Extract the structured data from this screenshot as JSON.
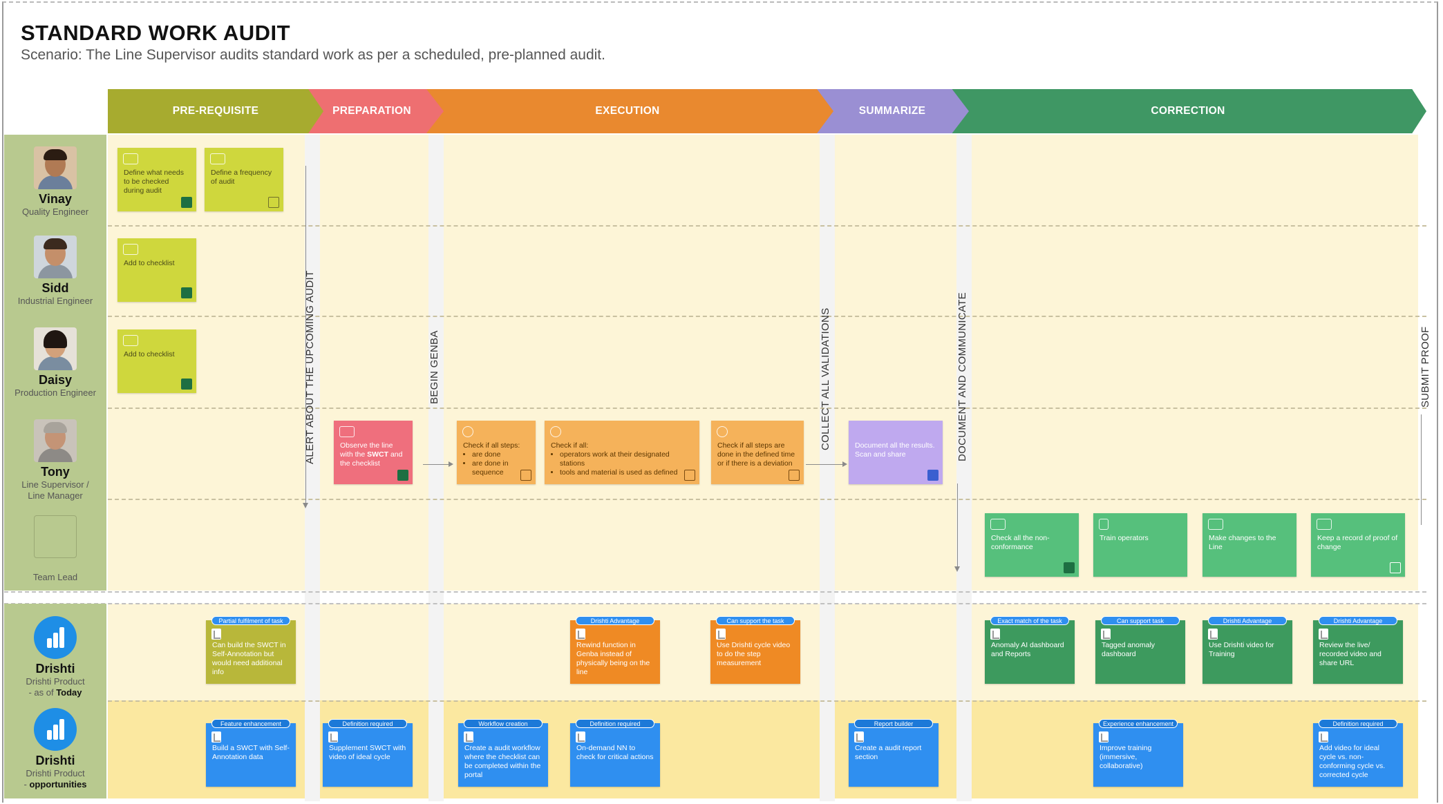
{
  "title": "STANDARD WORK AUDIT",
  "subtitle": "Scenario: The Line Supervisor audits standard work as per a scheduled, pre-planned audit.",
  "phases": [
    "PRE-REQUISITE",
    "PREPARATION",
    "EXECUTION",
    "SUMMARIZE",
    "CORRECTION"
  ],
  "colors": {
    "prerequisite": "#a7ab2f",
    "preparation": "#ee6f71",
    "execution": "#e9892f",
    "summarize": "#9a8fd3",
    "correction": "#3f9764",
    "lane": "#fdf5d7",
    "opportunity_lane": "#fbe8a0"
  },
  "personas": [
    {
      "name": "Vinay",
      "role": "Quality Engineer"
    },
    {
      "name": "Sidd",
      "role": "Industrial Engineer"
    },
    {
      "name": "Daisy",
      "role": "Production Engineer"
    },
    {
      "name": "Tony",
      "role": "Line Supervisor /",
      "role2": "Line Manager"
    },
    {
      "name": "",
      "role": "Team Lead"
    }
  ],
  "product_rows": [
    {
      "name": "Drishti",
      "line1": "Drishti Product",
      "line2a": "- as of ",
      "line2b": "Today"
    },
    {
      "name": "Drishti",
      "line1": "Drishti Product",
      "line2a": "- ",
      "line2b": "opportunities"
    }
  ],
  "transitions": [
    "ALERT ABOUT THE UPCOMING AUDIT",
    "BEGIN GENBA",
    "COLLECT ALL VALIDATIONS",
    "DOCUMENT AND COMMUNICATE",
    "SUBMIT PROOF"
  ],
  "cards": {
    "vinay1": "Define what needs to be checked during audit",
    "vinay2": "Define a frequency of audit",
    "sidd1": "Add to checklist",
    "daisy1": "Add to checklist",
    "tony_prep": {
      "pre": "Observe the line with the ",
      "bold": "SWCT",
      "post": " and the checklist"
    },
    "tony_exec1": {
      "lead": "Check if all steps:",
      "items": [
        "are done",
        "are done in sequence"
      ]
    },
    "tony_exec2": {
      "lead": "Check if all:",
      "items": [
        "operators work at their designated stations",
        "tools and material is used as defined"
      ]
    },
    "tony_exec3": "Check if all steps are done in the defined time or if there is a deviation",
    "tony_sum": "Document all the results. Scan and share",
    "lead1": "Check all the non-conformance",
    "lead2": "Train operators",
    "lead3": "Make changes to the Line",
    "lead4": "Keep a record of proof of change"
  },
  "today_cards": [
    {
      "tag": "Partial fulfilment of task",
      "text": "Can build the SWCT in Self-Annotation but would need additional info"
    },
    {
      "tag": "Drishti Advantage",
      "text": "Rewind function in Genba instead of physically being on the line"
    },
    {
      "tag": "Can support the task",
      "text": "Use Drishti cycle video to do the step measurement"
    },
    {
      "tag": "Exact match of the task",
      "text": "Anomaly AI dashboard and Reports"
    },
    {
      "tag": "Can support task",
      "text": "Tagged anomaly dashboard"
    },
    {
      "tag": "Drishti Advantage",
      "text": "Use Drishti video for Training"
    },
    {
      "tag": "Drishti Advantage",
      "text": "Review the live/ recorded video and share URL"
    }
  ],
  "opp_cards": [
    {
      "tag": "Feature enhancement",
      "text": "Build a SWCT with Self-Annotation data"
    },
    {
      "tag": "Definition required",
      "text": "Supplement SWCT with video of ideal cycle"
    },
    {
      "tag": "Workflow creation",
      "text": "Create a audit workflow where the checklist can be completed within the portal"
    },
    {
      "tag": "Definition required",
      "text": "On-demand NN to check for critical actions"
    },
    {
      "tag": "Report builder",
      "text": "Create a audit report section"
    },
    {
      "tag": "Experience enhancement",
      "text": "Improve training (immersive, collaborative)"
    },
    {
      "tag": "Definition required",
      "text": "Add video for ideal cycle vs. non-conforming cycle vs. corrected cycle"
    }
  ]
}
